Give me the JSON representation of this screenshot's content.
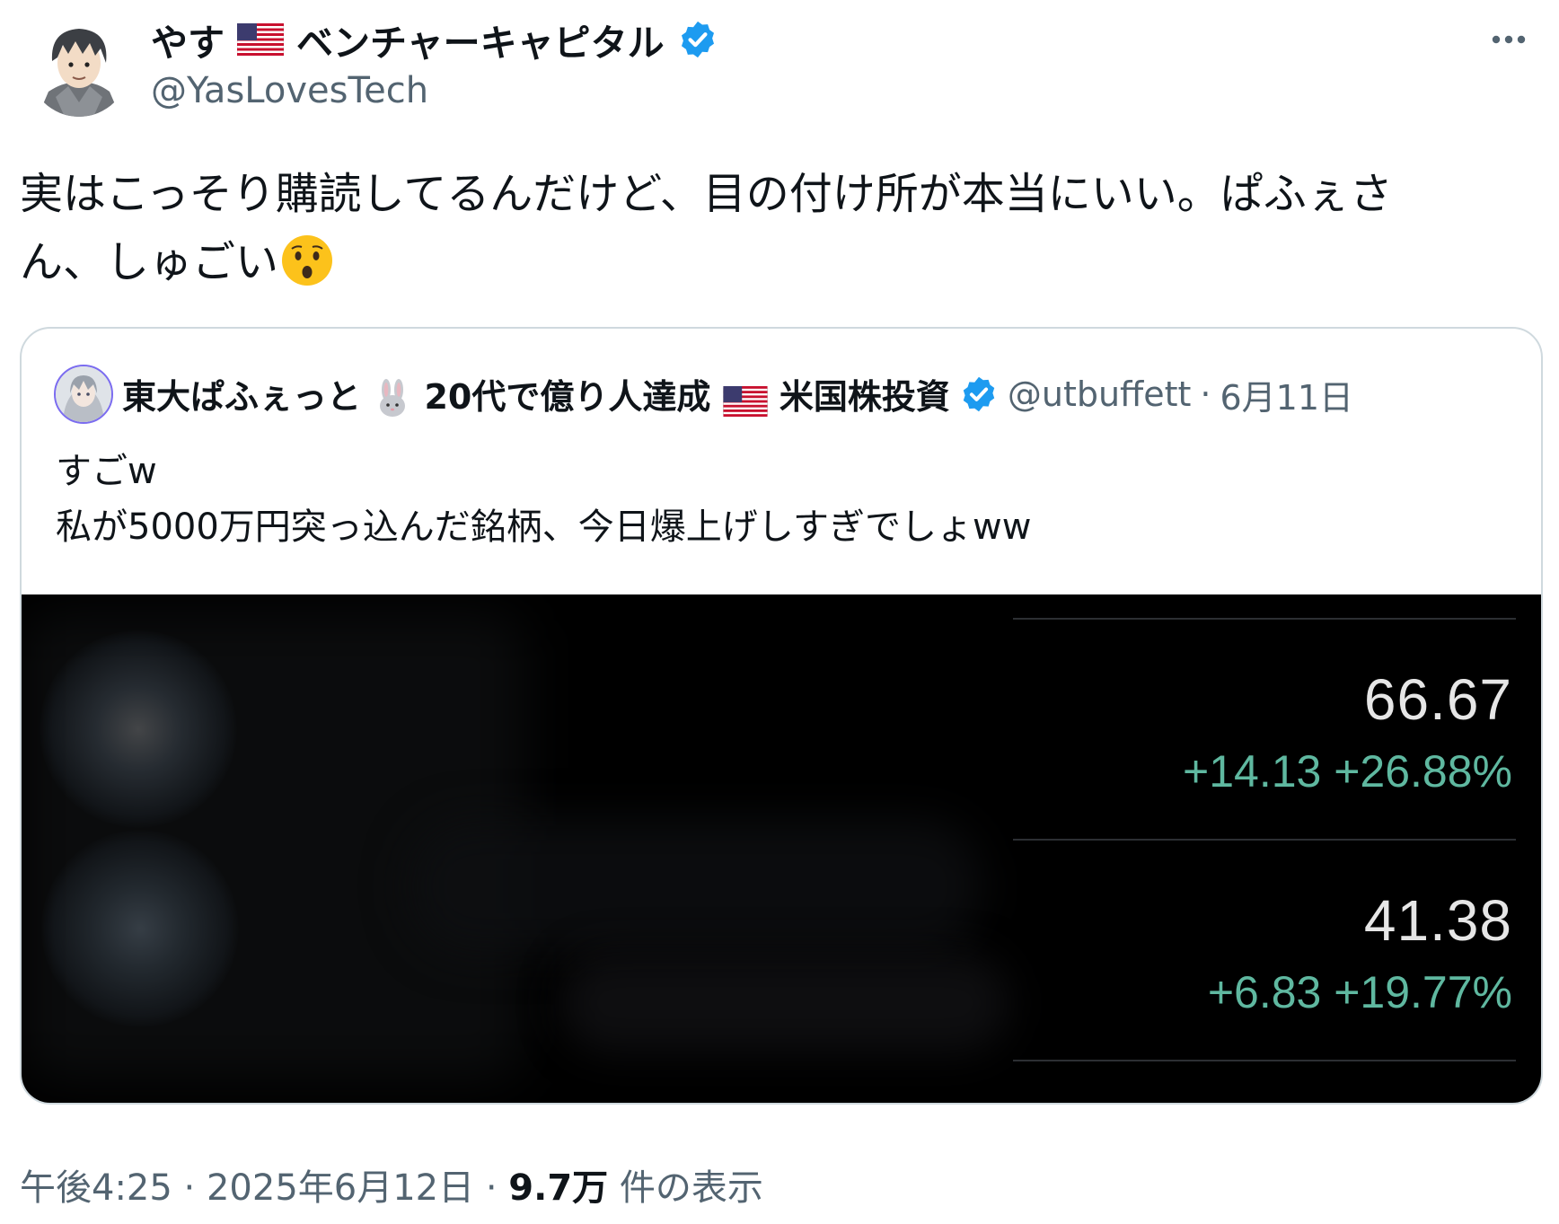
{
  "author": {
    "name_before_flag": "やす",
    "name_after_flag": "ベンチャーキャピタル",
    "handle": "@YasLovesTech",
    "flag_icon": "us-flag-icon",
    "verified_icon": "verified-badge-icon"
  },
  "tweet": {
    "line1": "実はこっそり購読してるんだけど、目の付け所が本当にいい。ぱふぇさ",
    "line2": "ん、しゅごい",
    "emoji": "hushed-face-emoji"
  },
  "quote": {
    "name_part1": "東大ぱふぇっと",
    "name_part2": "20代で億り人達成",
    "name_part3": "米国株投資",
    "handle": "@utbuffett",
    "separator": "·",
    "date": "6月11日",
    "text_line1": "すごw",
    "text_line2": "私が5000万円突っ込んだ銘柄、今日爆上げしすぎでしょww",
    "stocks": [
      {
        "price": "66.67",
        "change": "+14.13 +26.88%"
      },
      {
        "price": "41.38",
        "change": "+6.83 +19.77%"
      }
    ]
  },
  "footer": {
    "time": "午後4:25",
    "sep1": "·",
    "date": "2025年6月12日",
    "sep2": "·",
    "views_count": "9.7万",
    "views_label": "件の表示"
  },
  "colors": {
    "text": "#0f1419",
    "secondary": "#536471",
    "verified": "#1d9bf0",
    "gain_green": "#5fb8a0"
  }
}
